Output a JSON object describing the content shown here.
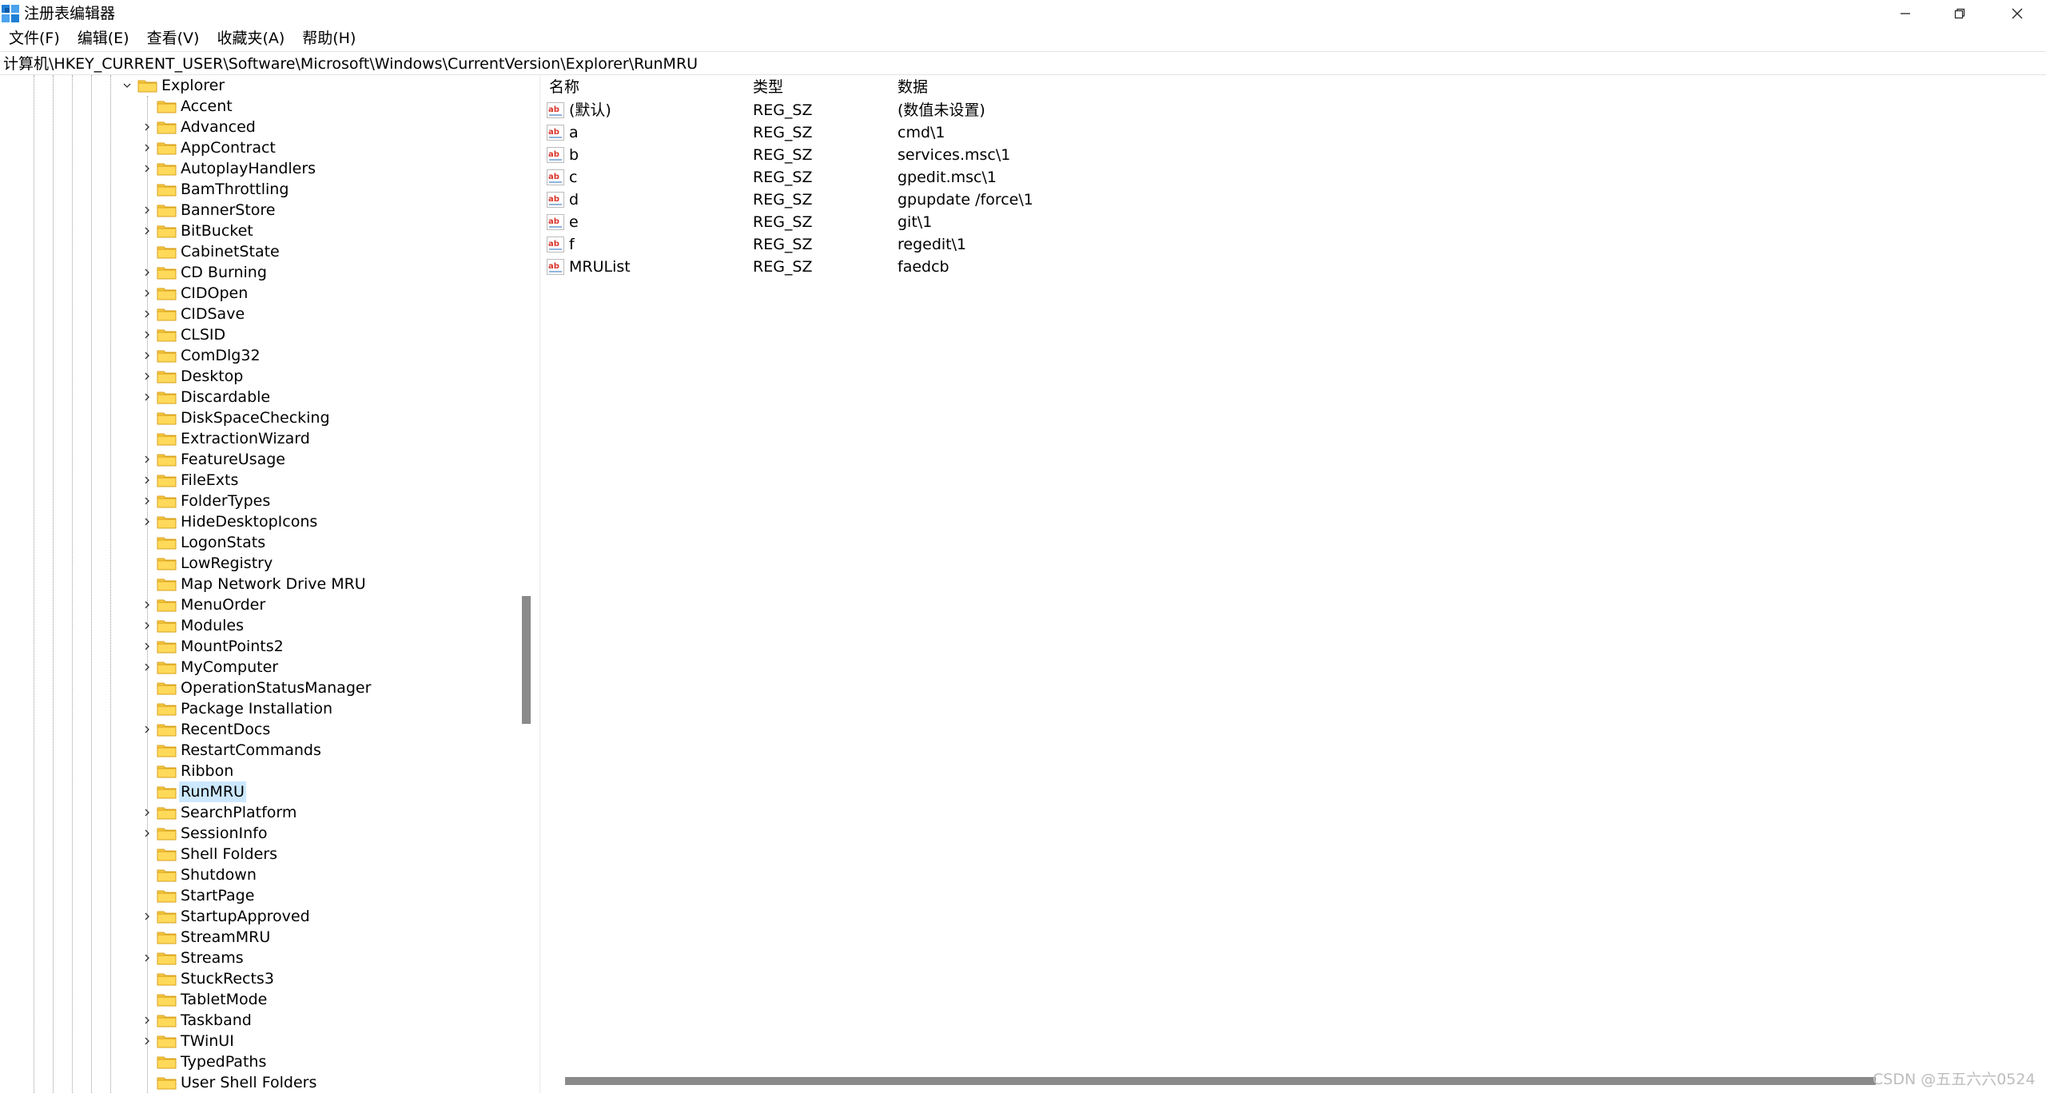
{
  "window": {
    "title": "注册表编辑器"
  },
  "menu": [
    {
      "label": "文件(F)"
    },
    {
      "label": "编辑(E)"
    },
    {
      "label": "查看(V)"
    },
    {
      "label": "收藏夹(A)"
    },
    {
      "label": "帮助(H)"
    }
  ],
  "address": {
    "path": "计算机\\HKEY_CURRENT_USER\\Software\\Microsoft\\Windows\\CurrentVersion\\Explorer\\RunMRU"
  },
  "tree": {
    "parent": {
      "label": "Explorer",
      "expanded": true
    },
    "children": [
      {
        "label": "Accent",
        "expandable": false,
        "selected": false
      },
      {
        "label": "Advanced",
        "expandable": true,
        "selected": false
      },
      {
        "label": "AppContract",
        "expandable": true,
        "selected": false
      },
      {
        "label": "AutoplayHandlers",
        "expandable": true,
        "selected": false
      },
      {
        "label": "BamThrottling",
        "expandable": false,
        "selected": false
      },
      {
        "label": "BannerStore",
        "expandable": true,
        "selected": false
      },
      {
        "label": "BitBucket",
        "expandable": true,
        "selected": false
      },
      {
        "label": "CabinetState",
        "expandable": false,
        "selected": false
      },
      {
        "label": "CD Burning",
        "expandable": true,
        "selected": false
      },
      {
        "label": "CIDOpen",
        "expandable": true,
        "selected": false
      },
      {
        "label": "CIDSave",
        "expandable": true,
        "selected": false
      },
      {
        "label": "CLSID",
        "expandable": true,
        "selected": false
      },
      {
        "label": "ComDlg32",
        "expandable": true,
        "selected": false
      },
      {
        "label": "Desktop",
        "expandable": true,
        "selected": false
      },
      {
        "label": "Discardable",
        "expandable": true,
        "selected": false
      },
      {
        "label": "DiskSpaceChecking",
        "expandable": false,
        "selected": false
      },
      {
        "label": "ExtractionWizard",
        "expandable": false,
        "selected": false
      },
      {
        "label": "FeatureUsage",
        "expandable": true,
        "selected": false
      },
      {
        "label": "FileExts",
        "expandable": true,
        "selected": false
      },
      {
        "label": "FolderTypes",
        "expandable": true,
        "selected": false
      },
      {
        "label": "HideDesktopIcons",
        "expandable": true,
        "selected": false
      },
      {
        "label": "LogonStats",
        "expandable": false,
        "selected": false
      },
      {
        "label": "LowRegistry",
        "expandable": false,
        "selected": false
      },
      {
        "label": "Map Network Drive MRU",
        "expandable": false,
        "selected": false
      },
      {
        "label": "MenuOrder",
        "expandable": true,
        "selected": false
      },
      {
        "label": "Modules",
        "expandable": true,
        "selected": false
      },
      {
        "label": "MountPoints2",
        "expandable": true,
        "selected": false
      },
      {
        "label": "MyComputer",
        "expandable": true,
        "selected": false
      },
      {
        "label": "OperationStatusManager",
        "expandable": false,
        "selected": false
      },
      {
        "label": "Package Installation",
        "expandable": false,
        "selected": false
      },
      {
        "label": "RecentDocs",
        "expandable": true,
        "selected": false
      },
      {
        "label": "RestartCommands",
        "expandable": false,
        "selected": false
      },
      {
        "label": "Ribbon",
        "expandable": false,
        "selected": false
      },
      {
        "label": "RunMRU",
        "expandable": false,
        "selected": true
      },
      {
        "label": "SearchPlatform",
        "expandable": true,
        "selected": false
      },
      {
        "label": "SessionInfo",
        "expandable": true,
        "selected": false
      },
      {
        "label": "Shell Folders",
        "expandable": false,
        "selected": false
      },
      {
        "label": "Shutdown",
        "expandable": false,
        "selected": false
      },
      {
        "label": "StartPage",
        "expandable": false,
        "selected": false
      },
      {
        "label": "StartupApproved",
        "expandable": true,
        "selected": false
      },
      {
        "label": "StreamMRU",
        "expandable": false,
        "selected": false
      },
      {
        "label": "Streams",
        "expandable": true,
        "selected": false
      },
      {
        "label": "StuckRects3",
        "expandable": false,
        "selected": false
      },
      {
        "label": "TabletMode",
        "expandable": false,
        "selected": false
      },
      {
        "label": "Taskband",
        "expandable": true,
        "selected": false
      },
      {
        "label": "TWinUI",
        "expandable": true,
        "selected": false
      },
      {
        "label": "TypedPaths",
        "expandable": false,
        "selected": false
      },
      {
        "label": "User Shell Folders",
        "expandable": false,
        "selected": false
      }
    ]
  },
  "values": {
    "columns": {
      "name": "名称",
      "type": "类型",
      "data": "数据"
    },
    "rows": [
      {
        "name": "(默认)",
        "type": "REG_SZ",
        "data": "(数值未设置)"
      },
      {
        "name": "a",
        "type": "REG_SZ",
        "data": "cmd\\1"
      },
      {
        "name": "b",
        "type": "REG_SZ",
        "data": "services.msc\\1"
      },
      {
        "name": "c",
        "type": "REG_SZ",
        "data": "gpedit.msc\\1"
      },
      {
        "name": "d",
        "type": "REG_SZ",
        "data": "gpupdate /force\\1"
      },
      {
        "name": "e",
        "type": "REG_SZ",
        "data": "git\\1"
      },
      {
        "name": "f",
        "type": "REG_SZ",
        "data": "regedit\\1"
      },
      {
        "name": "MRUList",
        "type": "REG_SZ",
        "data": "faedcb"
      }
    ]
  },
  "watermark": "CSDN @五五六六0524",
  "colors": {
    "selection": "#cce8ff",
    "folder": "#f5c842",
    "folder_edge": "#d9a21b",
    "reg_icon": "#d9342b"
  }
}
